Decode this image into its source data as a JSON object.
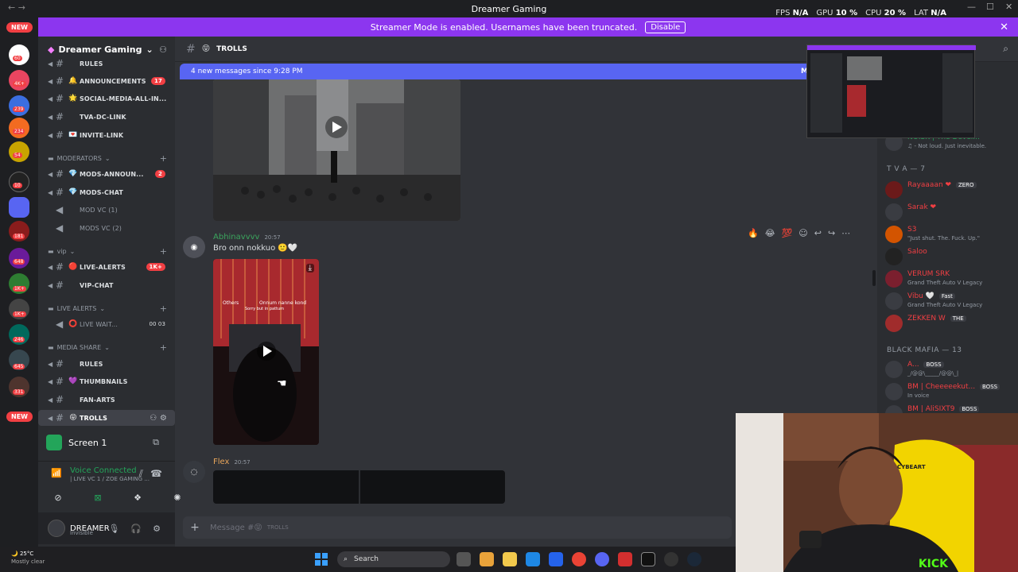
{
  "titlebar": {
    "title": "Dreamer Gaming",
    "stats": [
      {
        "label": "FPS",
        "value": "N/A"
      },
      {
        "label": "GPU",
        "value": "10 %"
      },
      {
        "label": "CPU",
        "value": "20 %"
      },
      {
        "label": "LAT",
        "value": "N/A"
      }
    ]
  },
  "banner": {
    "text": "Streamer Mode is enabled. Usernames have been truncated.",
    "button": "Disable"
  },
  "rail": {
    "new_top": "NEW",
    "new_bottom": "NEW",
    "badges": [
      "60",
      "4K+",
      "239",
      "234",
      "54",
      "10",
      "181",
      "648",
      "1K+",
      "1K+",
      "246",
      "645",
      "331"
    ]
  },
  "server": {
    "name": "Dreamer Gaming"
  },
  "channels": [
    {
      "name": "RULES",
      "emoji": "",
      "type": "text",
      "count": ""
    },
    {
      "name": "ANNOUNCEMENTS",
      "emoji": "🔔",
      "type": "text",
      "count": "17"
    },
    {
      "name": "SOCIAL-MEDIA-ALL-IN...",
      "emoji": "🌟",
      "type": "text",
      "count": ""
    },
    {
      "name": "TVA-DC-LINK",
      "emoji": "",
      "type": "text",
      "count": ""
    },
    {
      "name": "INVITE-LINK",
      "emoji": "💌",
      "type": "text",
      "count": ""
    }
  ],
  "mod_category": "MODERATORS",
  "mod_channels": [
    {
      "name": "MODS-ANNOUN...",
      "emoji": "💎",
      "type": "text",
      "count": "2"
    },
    {
      "name": "MODS-CHAT",
      "emoji": "💎",
      "type": "text",
      "count": ""
    },
    {
      "name": "MOD VC (1)",
      "emoji": "",
      "type": "voice",
      "count": ""
    },
    {
      "name": "MODS VC (2)",
      "emoji": "",
      "type": "voice",
      "count": ""
    }
  ],
  "vip_category": "vip",
  "vip_channels": [
    {
      "name": "LIVE-ALERTS",
      "emoji": "🔴",
      "type": "text",
      "count": "1K+"
    },
    {
      "name": "VIP-CHAT",
      "emoji": "",
      "type": "text",
      "count": ""
    }
  ],
  "live_category": "LIVE ALERTS",
  "live_channels": [
    {
      "name": "LIVE WAIT...",
      "emoji": "⭕",
      "type": "voice",
      "count": "00 03"
    }
  ],
  "media_category": "MEDIA SHARE",
  "media_channels": [
    {
      "name": "RULES",
      "emoji": "",
      "type": "text",
      "count": ""
    },
    {
      "name": "THUMBNAILS",
      "emoji": "💜",
      "type": "text",
      "count": ""
    },
    {
      "name": "FAN-ARTS",
      "emoji": "",
      "type": "text",
      "count": ""
    },
    {
      "name": "TROLLS",
      "emoji": "😝",
      "type": "text",
      "count": ""
    }
  ],
  "screenshare": {
    "label": "Screen 1"
  },
  "voice": {
    "title": "Voice Connected",
    "sub": "| LIVE VC 1 / ZOE GAMING ..."
  },
  "user": {
    "name": "DREAMER",
    "status": "Invisible"
  },
  "channel_header": {
    "emoji": "😝",
    "name": "TROLLS"
  },
  "new_messages": {
    "text": "4 new messages since 9:28 PM",
    "mark": "M"
  },
  "messages": [
    {
      "user": "Abhinavvvv",
      "time": "20:57",
      "text": "Bro onn nokkuo 🙂🤍",
      "color": "#3ba55d"
    },
    {
      "user": "Flex",
      "time": "20:57",
      "text": "",
      "color": "#e8a55a"
    }
  ],
  "media2_caption": {
    "top": "Others",
    "right": "Onnum nanne kond",
    "sub": "Sorry but in pattum"
  },
  "composer": {
    "placeholder": "Message #😝",
    "channel": "TROLLS"
  },
  "members": {
    "top_user": {
      "name": "NOISK | The Devel...",
      "sub": "♫ - Not loud. Just inevitable."
    },
    "group1": "T V A — 7",
    "tva": [
      {
        "name": "Rayaaaan",
        "tag": "ZERO",
        "sub": "",
        "color": "#f23f43"
      },
      {
        "name": "Sarak",
        "tag": "",
        "sub": "",
        "color": "#f23f43"
      },
      {
        "name": "S3",
        "tag": "",
        "sub": "\"Just shut. The. Fuck. Up.\"",
        "color": "#f23f43"
      },
      {
        "name": "Saloo",
        "tag": "",
        "sub": "",
        "color": "#f23f43"
      },
      {
        "name": "VERUM SRK",
        "tag": "",
        "sub": "Grand Theft Auto V Legacy",
        "color": "#f23f43"
      },
      {
        "name": "Vibu",
        "tag": "Fast",
        "sub": "Grand Theft Auto V Legacy",
        "color": "#f23f43"
      },
      {
        "name": "ZEKKEN W",
        "tag": "THE",
        "sub": "",
        "color": "#f23f43"
      }
    ],
    "group2": "BLACK MAFIA — 13",
    "mafia": [
      {
        "name": "A...",
        "tag": "BOSS",
        "sub": "_/@@\\_____/@@\\_|",
        "color": "#f23f43"
      },
      {
        "name": "BM | Cheeeeekut...",
        "tag": "BOSS",
        "sub": "In voice",
        "color": "#f23f43"
      },
      {
        "name": "BM | AliSIXT9",
        "tag": "BOSS",
        "sub": "",
        "color": "#f23f43"
      }
    ]
  },
  "webcam": {
    "brand": "CYBEART",
    "stream_label": "KICK"
  },
  "taskbar": {
    "temp": "25°C",
    "weather": "Mostly clear",
    "search": "Search"
  }
}
